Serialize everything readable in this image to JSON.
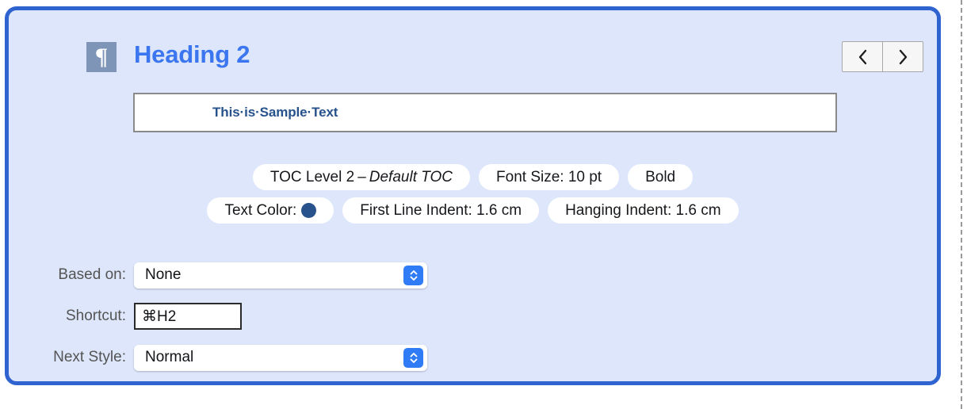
{
  "panel": {
    "icon_glyph": "¶",
    "title": "Heading 2",
    "nav": {
      "prev_label": "‹",
      "next_label": "›"
    }
  },
  "preview": {
    "sample_text": "This·is·Sample·Text"
  },
  "attributes": {
    "row1": [
      {
        "prefix": "TOC Level 2",
        "dash": "–",
        "emphasis": "Default TOC"
      },
      {
        "text": "Font Size: 10 pt"
      },
      {
        "text": "Bold"
      }
    ],
    "row2": [
      {
        "text": "Text Color:",
        "swatch": "#27528c"
      },
      {
        "text": "First Line Indent: 1.6 cm"
      },
      {
        "text": "Hanging Indent: 1.6 cm"
      }
    ]
  },
  "form": {
    "based_on": {
      "label": "Based on:",
      "value": "None"
    },
    "shortcut": {
      "label": "Shortcut:",
      "value": "⌘H2"
    },
    "next_style": {
      "label": "Next Style:",
      "value": "Normal"
    }
  },
  "colors": {
    "panel_border": "#2f63d0",
    "panel_fill": "#dde6fa",
    "title": "#3b76f0",
    "sample_text": "#27528c",
    "icon_background": "#7e95b8",
    "popup_accent": "#2f7cf6"
  }
}
